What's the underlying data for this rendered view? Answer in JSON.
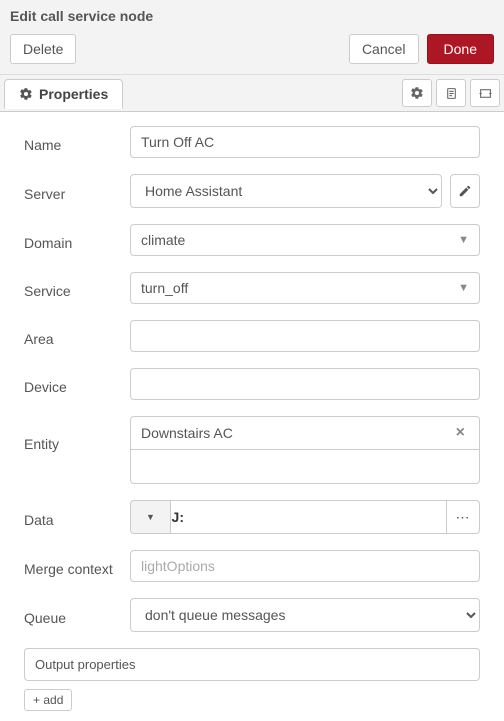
{
  "header": {
    "title": "Edit call service node",
    "delete": "Delete",
    "cancel": "Cancel",
    "done": "Done"
  },
  "tabs": {
    "properties": "Properties"
  },
  "form": {
    "name_label": "Name",
    "name_value": "Turn Off AC",
    "server_label": "Server",
    "server_value": "Home Assistant",
    "domain_label": "Domain",
    "domain_value": "climate",
    "service_label": "Service",
    "service_value": "turn_off",
    "area_label": "Area",
    "area_value": "",
    "device_label": "Device",
    "device_value": "",
    "entity_label": "Entity",
    "entity_chip": "Downstairs AC",
    "data_label": "Data",
    "data_value": "",
    "data_prefix": "J:",
    "merge_label": "Merge context",
    "merge_placeholder": "lightOptions",
    "queue_label": "Queue",
    "queue_value": "don't queue messages",
    "output_props": "Output properties",
    "add_label": "+ add"
  }
}
